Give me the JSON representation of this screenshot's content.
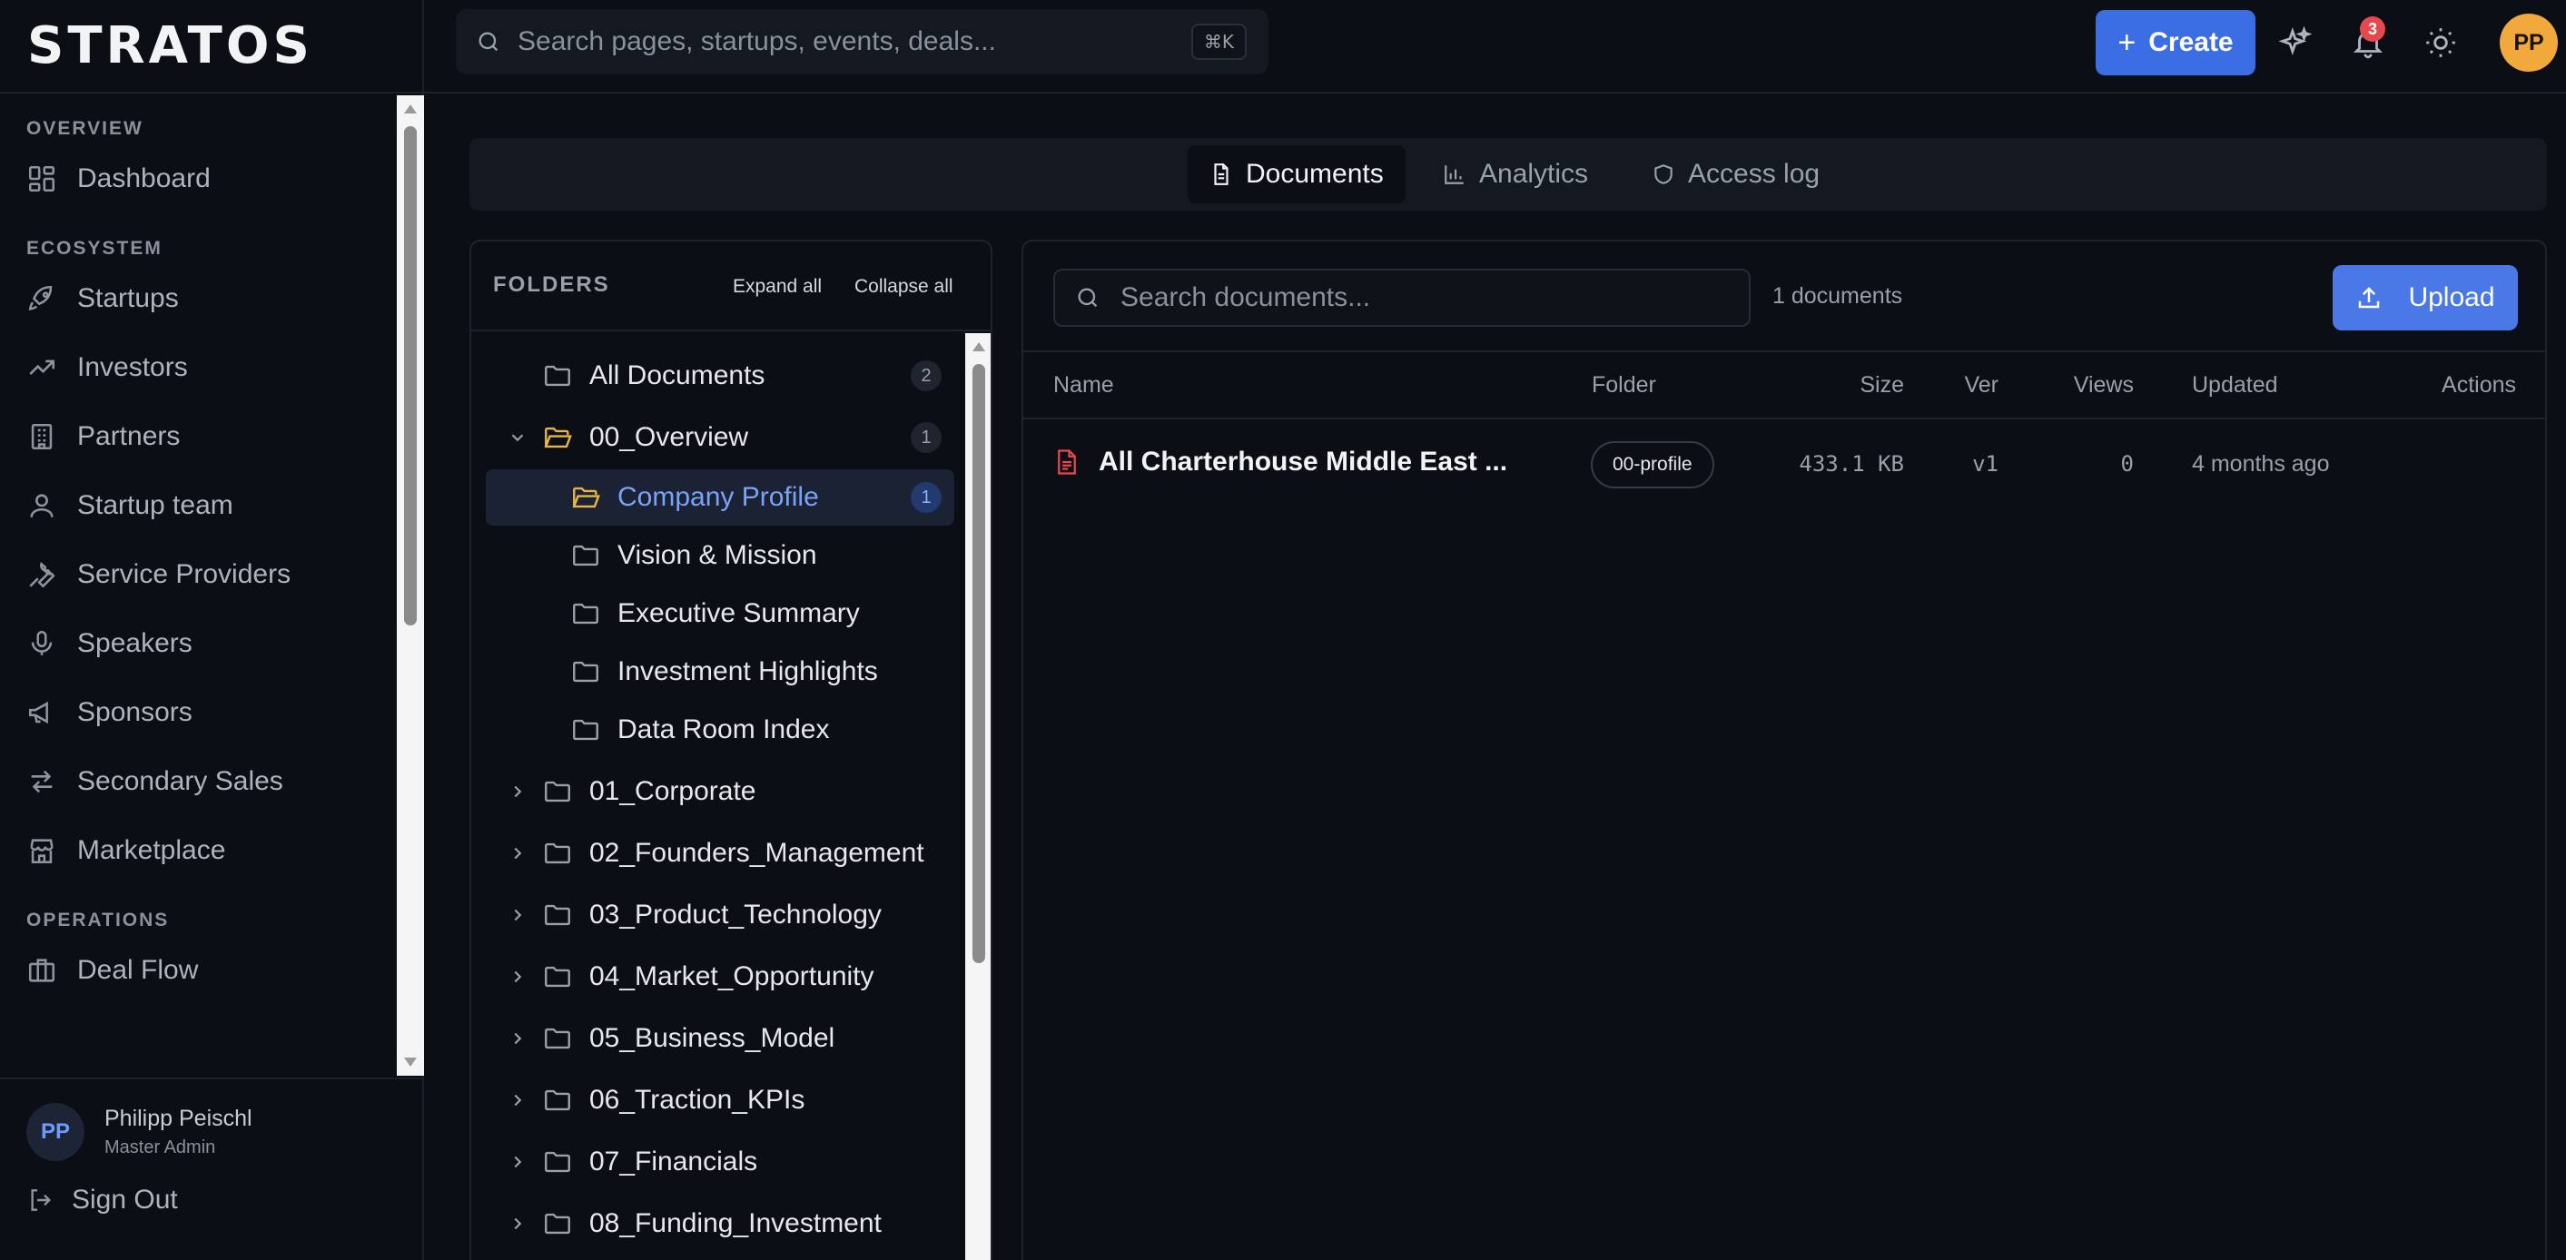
{
  "app": {
    "logo": "STRATOS",
    "search_placeholder": "Search pages, startups, events, deals...",
    "shortcut": "⌘K",
    "create_label": "Create",
    "notification_count": "3",
    "user_initials": "PP",
    "accent": "#3b6de3"
  },
  "sidebar": {
    "sections": [
      {
        "title": "OVERVIEW",
        "items": [
          {
            "label": "Dashboard",
            "icon": "dashboard-icon"
          }
        ]
      },
      {
        "title": "ECOSYSTEM",
        "items": [
          {
            "label": "Startups",
            "icon": "rocket-icon"
          },
          {
            "label": "Investors",
            "icon": "trending-up-icon"
          },
          {
            "label": "Partners",
            "icon": "building-icon"
          },
          {
            "label": "Startup team",
            "icon": "user-icon"
          },
          {
            "label": "Service Providers",
            "icon": "wrench-icon"
          },
          {
            "label": "Speakers",
            "icon": "microphone-icon"
          },
          {
            "label": "Sponsors",
            "icon": "megaphone-icon"
          },
          {
            "label": "Secondary Sales",
            "icon": "swap-icon"
          },
          {
            "label": "Marketplace",
            "icon": "store-icon"
          }
        ]
      },
      {
        "title": "OPERATIONS",
        "items": [
          {
            "label": "Deal Flow",
            "icon": "briefcase-icon"
          }
        ]
      }
    ],
    "user": {
      "initials": "PP",
      "name": "Philipp Peischl",
      "role": "Master Admin"
    },
    "sign_out": "Sign Out"
  },
  "tabs": [
    {
      "label": "Documents",
      "icon": "document-icon",
      "active": true
    },
    {
      "label": "Analytics",
      "icon": "bar-chart-icon",
      "active": false
    },
    {
      "label": "Access log",
      "icon": "shield-icon",
      "active": false
    }
  ],
  "folders": {
    "title": "FOLDERS",
    "expand_all": "Expand all",
    "collapse_all": "Collapse all",
    "tree": [
      {
        "label": "All Documents",
        "count": "2",
        "level": 0,
        "chevron": "none"
      },
      {
        "label": "00_Overview",
        "count": "1",
        "level": 0,
        "chevron": "down",
        "open": true
      },
      {
        "label": "Company Profile",
        "count": "1",
        "level": 1,
        "chevron": "none",
        "selected": true
      },
      {
        "label": "Vision & Mission",
        "count": "",
        "level": 1,
        "chevron": "none"
      },
      {
        "label": "Executive Summary",
        "count": "",
        "level": 1,
        "chevron": "none"
      },
      {
        "label": "Investment Highlights",
        "count": "",
        "level": 1,
        "chevron": "none"
      },
      {
        "label": "Data Room Index",
        "count": "",
        "level": 1,
        "chevron": "none"
      },
      {
        "label": "01_Corporate",
        "count": "",
        "level": 0,
        "chevron": "right"
      },
      {
        "label": "02_Founders_Management",
        "count": "",
        "level": 0,
        "chevron": "right"
      },
      {
        "label": "03_Product_Technology",
        "count": "",
        "level": 0,
        "chevron": "right"
      },
      {
        "label": "04_Market_Opportunity",
        "count": "",
        "level": 0,
        "chevron": "right"
      },
      {
        "label": "05_Business_Model",
        "count": "",
        "level": 0,
        "chevron": "right"
      },
      {
        "label": "06_Traction_KPIs",
        "count": "",
        "level": 0,
        "chevron": "right"
      },
      {
        "label": "07_Financials",
        "count": "",
        "level": 0,
        "chevron": "right"
      },
      {
        "label": "08_Funding_Investment",
        "count": "",
        "level": 0,
        "chevron": "right"
      }
    ]
  },
  "documents": {
    "search_placeholder": "Search documents...",
    "count_label": "1 documents",
    "upload_label": "Upload",
    "columns": {
      "name": "Name",
      "folder": "Folder",
      "size": "Size",
      "ver": "Ver",
      "views": "Views",
      "updated": "Updated",
      "actions": "Actions"
    },
    "rows": [
      {
        "name": "All Charterhouse Middle East ...",
        "folder": "00-profile",
        "size": "433.1 KB",
        "ver": "v1",
        "views": "0",
        "updated": "4 months ago"
      }
    ]
  }
}
